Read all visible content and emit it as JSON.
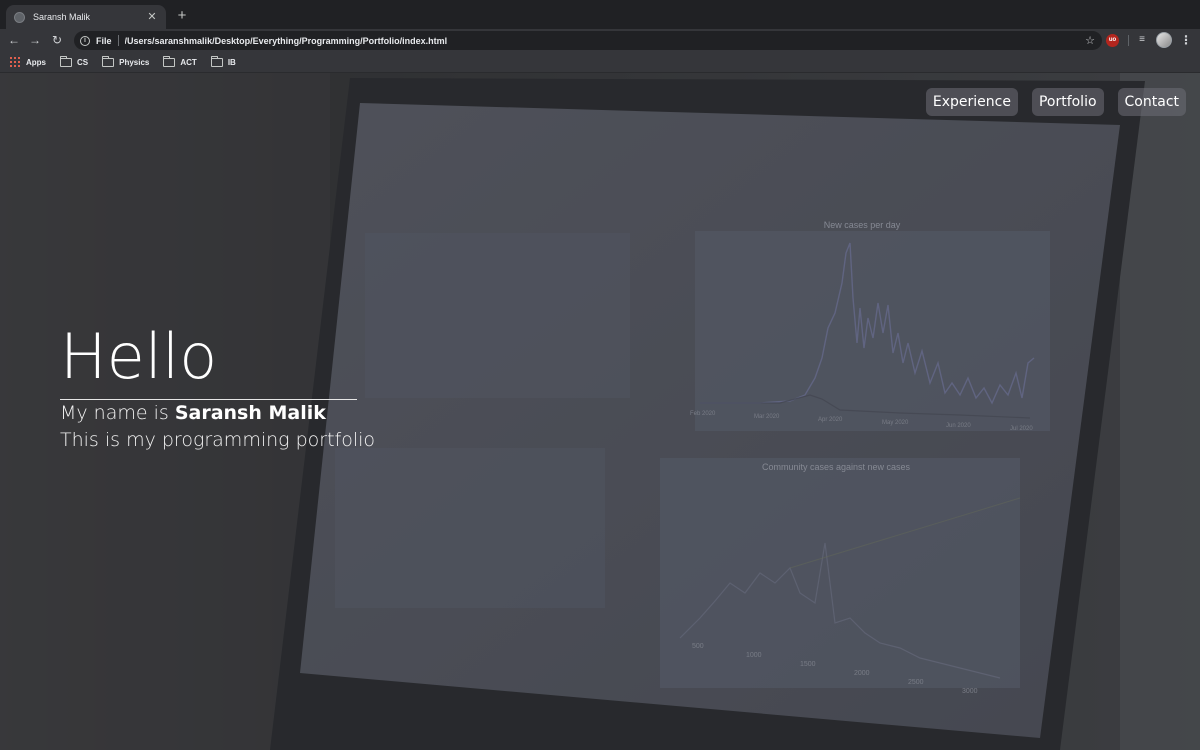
{
  "browser": {
    "tab": {
      "title": "Saransh Malik",
      "close_glyph": "✕",
      "favicon": "globe-icon"
    },
    "new_tab_glyph": "+",
    "toolbar": {
      "back_glyph": "←",
      "forward_glyph": "→",
      "reload_glyph": "↻",
      "scheme": "File",
      "url": "/Users/saranshmalik/Desktop/Everything/Programming/Portfolio/index.html",
      "star_glyph": "☆",
      "ublock_label": "uo",
      "menu_glyph": "⋮"
    },
    "bookmarks": [
      {
        "label": "Apps",
        "icon": "apps-grid-icon"
      },
      {
        "label": "CS",
        "icon": "folder-icon"
      },
      {
        "label": "Physics",
        "icon": "folder-icon"
      },
      {
        "label": "ACT",
        "icon": "folder-icon"
      },
      {
        "label": "IB",
        "icon": "folder-icon"
      }
    ]
  },
  "page": {
    "nav": [
      "Experience",
      "Portfolio",
      "Contact"
    ],
    "hero": {
      "title": "Hello",
      "intro_prefix": "My name is",
      "name": "Saransh Malik",
      "tagline": "This is my programming portfolio"
    },
    "background": {
      "chart_top_right_title": "New cases per day",
      "chart_bottom_right_title": "Community cases against new cases",
      "x_ticks_top": [
        "Feb 2020",
        "Mar 2020",
        "Apr 2020",
        "May 2020",
        "Jun 2020",
        "Jul 2020"
      ],
      "x_ticks_bottom": [
        "500",
        "1000",
        "1500",
        "2000",
        "2500",
        "3000"
      ],
      "overlay_color": "#3a3b40"
    }
  }
}
